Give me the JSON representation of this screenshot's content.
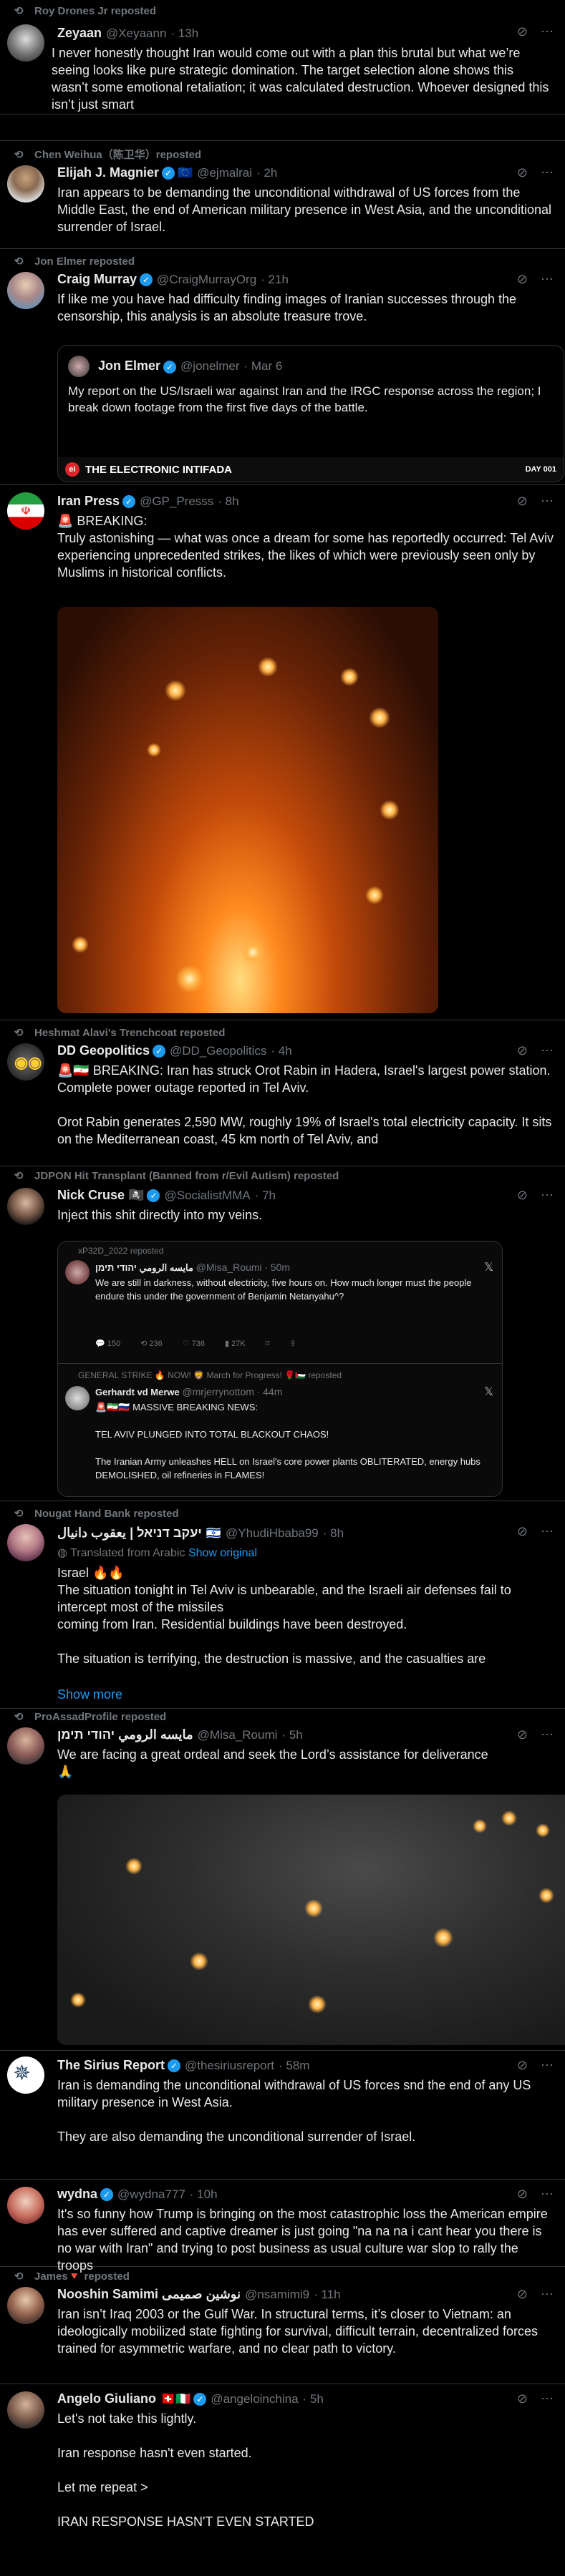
{
  "posts": [
    {
      "repost_by": "Roy Drones Jr reposted",
      "name": "Zeyaan",
      "handle": "@Xeyaann",
      "time": "· 13h",
      "text": "I never honestly thought Iran would come out with a plan this brutal but what we’re seeing looks like pure strategic domination. The target selection alone shows this wasn’t some emotional retaliation; it was calculated destruction. Whoever designed this isn’t just smart"
    },
    {
      "repost_by": "Chen Weihua（陈卫华）reposted",
      "name": "Elijah J. Magnier",
      "flags": "🇪🇺",
      "handle": "@ejmalrai",
      "time": "· 2h",
      "text": "Iran appears to be demanding the unconditional withdrawal of US forces from the Middle East, the end of American military presence in West Asia, and the unconditional surrender of Israel."
    },
    {
      "repost_by": "Jon Elmer reposted",
      "name": "Craig Murray",
      "handle": "@CraigMurrayOrg",
      "time": "· 21h",
      "text": "If like me you have had difficulty finding images of Iranian successes through the censorship, this analysis is an absolute treasure trove.",
      "quote": {
        "name": "Jon Elmer",
        "handle": "@jonelmer",
        "time": "· Mar 6",
        "text": "My report on the US/Israeli war against Iran and the IRGC response across the region; I break down footage from the first five days of the battle.",
        "banner": "THE ELECTRONIC INTIFADA",
        "banner_right": "DAY 001"
      }
    },
    {
      "name": "Iran Press",
      "handle": "@GP_Presss",
      "time": "· 8h",
      "text": "🚨 BREAKING:\nTruly astonishing — what was once a dream for some has reportedly occurred: Tel Aviv experiencing unprecedented strikes, the likes of which were previously seen only by Muslims in historical conflicts."
    },
    {
      "repost_by": "Heshmat Alavi's Trenchcoat reposted",
      "name": "DD Geopolitics",
      "handle": "@DD_Geopolitics",
      "time": "· 4h",
      "text": "🚨🇮🇷 BREAKING: Iran has struck Orot Rabin in Hadera, Israel's largest power station. Complete power outage reported in Tel Aviv.\n\nOrot Rabin generates 2,590 MW, roughly 19% of Israel's total electricity capacity. It sits on the Mediterranean coast, 45 km north of Tel Aviv, and"
    },
    {
      "repost_by": "JDPON Hit Transplant (Banned from r/Evil Autism) reposted",
      "name": "Nick Cruse 🏴‍☠️",
      "handle": "@SocialistMMA",
      "time": "· 7h",
      "text": "Inject this shit directly into my veins.",
      "quote1": {
        "ctx": "xP32D_2022 reposted",
        "name": "مايسه الرومي יהודי תימן",
        "handle": "@Misa_Roumi",
        "time": "· 50m",
        "text": "We are still in darkness, without electricity, five hours on. How much longer must the people endure this under the government of Benjamin Netanyahu^?",
        "stats": [
          "150",
          "236",
          "736",
          "27K"
        ]
      },
      "quote2": {
        "ctx": "GENERAL STRIKE 🔥 NOW! 🦁 March for Progress! 🌹🇵🇸 reposted",
        "name": "Gerhardt vd Merwe",
        "handle": "@mrjerrynottom",
        "time": "· 44m",
        "text": "🚨🇮🇷🇷🇺 MASSIVE BREAKING NEWS:\n\nTEL AVIV PLUNGED INTO TOTAL BLACKOUT CHAOS!\n\nThe Iranian Army unleashes HELL on Israel's core power plants OBLITERATED, energy hubs DEMOLISHED, oil refineries in FLAMES!"
      }
    },
    {
      "repost_by": "Nougat Hand Bank reposted",
      "name": "יעקב דניאל | يعقوب دانيال",
      "flags": "🇮🇱",
      "handle": "@YhudiHbaba99",
      "time": "· 8h",
      "translated": "Translated from Arabic",
      "show_original": "Show original",
      "text": "Israel 🔥🔥\nThe situation tonight in Tel Aviv is unbearable, and the Israeli air defenses fail to intercept most of the missiles\ncoming from Iran. Residential buildings have been destroyed.\n\nThe situation is terrifying, the destruction is massive, and the casualties are",
      "show_more": "Show more"
    },
    {
      "repost_by": "ProAssadProfile reposted",
      "name": "مايسه الرومي יהודי תימן",
      "handle": "@Misa_Roumi",
      "time": "· 5h",
      "text": "We are facing a great ordeal and seek the Lord’s assistance for deliverance\n🙏"
    },
    {
      "name": "The Sirius Report",
      "handle": "@thesiriusreport",
      "time": "· 58m",
      "text": "Iran is demanding the unconditional withdrawal of US forces snd the end of any US military presence in West Asia.\n\nThey are also demanding the unconditional surrender of Israel."
    },
    {
      "name": "wydna",
      "handle": "@wydna777",
      "time": "· 10h",
      "text": "It's so funny how Trump is bringing on the most catastrophic loss the American empire has ever suffered and captive dreamer is just going \"na na na i cant hear you there is no war with Iran\" and trying to post business as usual culture war slop to rally the troops"
    },
    {
      "repost_by": "James🔻 reposted",
      "name": "Nooshin Samimi نوشین صمیمی",
      "handle": "@nsamimi9",
      "time": "· 11h",
      "text": "Iran isn’t Iraq 2003 or the Gulf War. In structural terms, it’s closer to Vietnam: an ideologically mobilized state fighting for survival, difficult terrain, decentralized forces trained for asymmetric warfare, and no clear path to victory."
    },
    {
      "name": "Angelo Giuliano",
      "flags": "🇨🇭🇮🇹",
      "handle": "@angeloinchina",
      "time": "· 5h",
      "text": "Let's not take this lightly.\n\nIran response hasn't even started.\n\nLet me repeat >\n\nIRAN RESPONSE HASN'T EVEN STARTED"
    }
  ]
}
